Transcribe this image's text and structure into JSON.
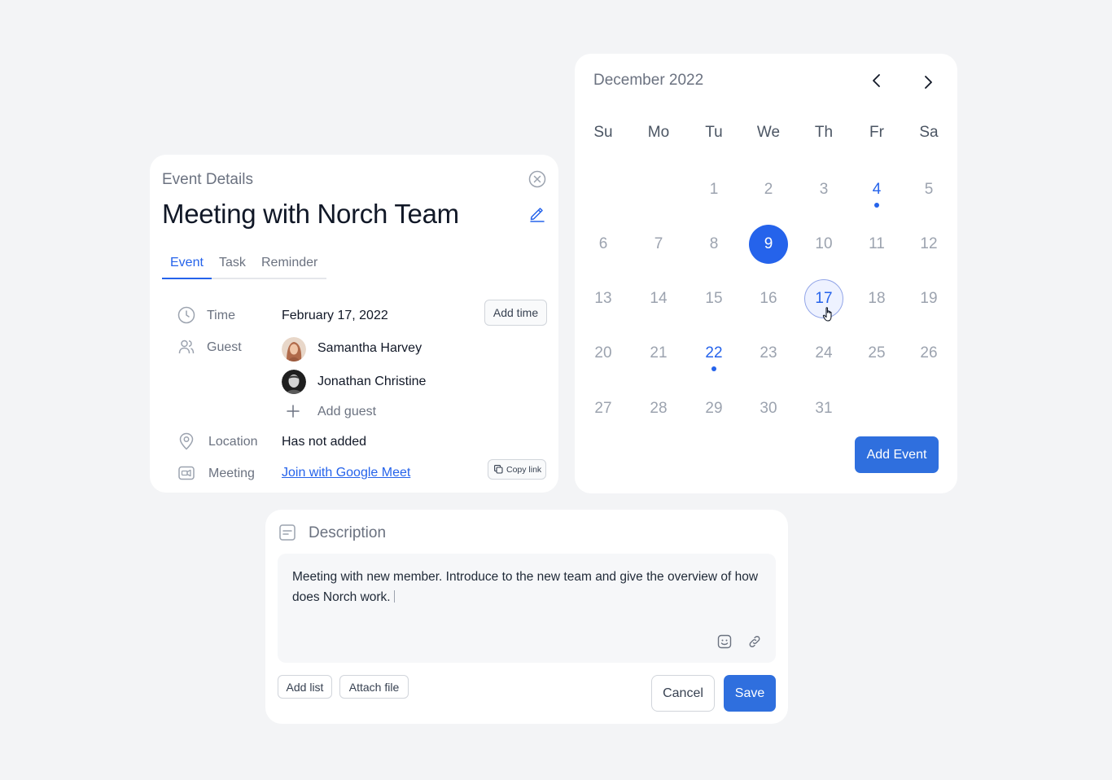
{
  "event_details": {
    "label": "Event Details",
    "title": "Meeting with Norch Team",
    "tabs": [
      {
        "label": "Event",
        "active": true
      },
      {
        "label": "Task",
        "active": false
      },
      {
        "label": "Reminder",
        "active": false
      }
    ],
    "time": {
      "label": "Time",
      "value": "February 17, 2022",
      "button": "Add time"
    },
    "guest": {
      "label": "Guest",
      "guests": [
        {
          "name": "Samantha Harvey"
        },
        {
          "name": "Jonathan Christine"
        }
      ],
      "add_label": "Add guest"
    },
    "location": {
      "label": "Location",
      "value": "Has not added"
    },
    "meeting": {
      "label": "Meeting",
      "link": "Join with Google Meet",
      "copy_label": "Copy link"
    }
  },
  "calendar": {
    "month": "December 2022",
    "weekdays": [
      "Su",
      "Mo",
      "Tu",
      "We",
      "Th",
      "Fr",
      "Sa"
    ],
    "first_weekday_index": 2,
    "days_in_month": 31,
    "selected_day": 9,
    "hovered_day": 17,
    "event_days": [
      4,
      22
    ],
    "add_event_label": "Add Event",
    "accent_color": "#2563eb"
  },
  "description": {
    "label": "Description",
    "text": "Meeting with new member. Introduce to the new team and give the overview of how does Norch work.",
    "add_list_label": "Add list",
    "attach_file_label": "Attach file",
    "cancel_label": "Cancel",
    "save_label": "Save"
  }
}
